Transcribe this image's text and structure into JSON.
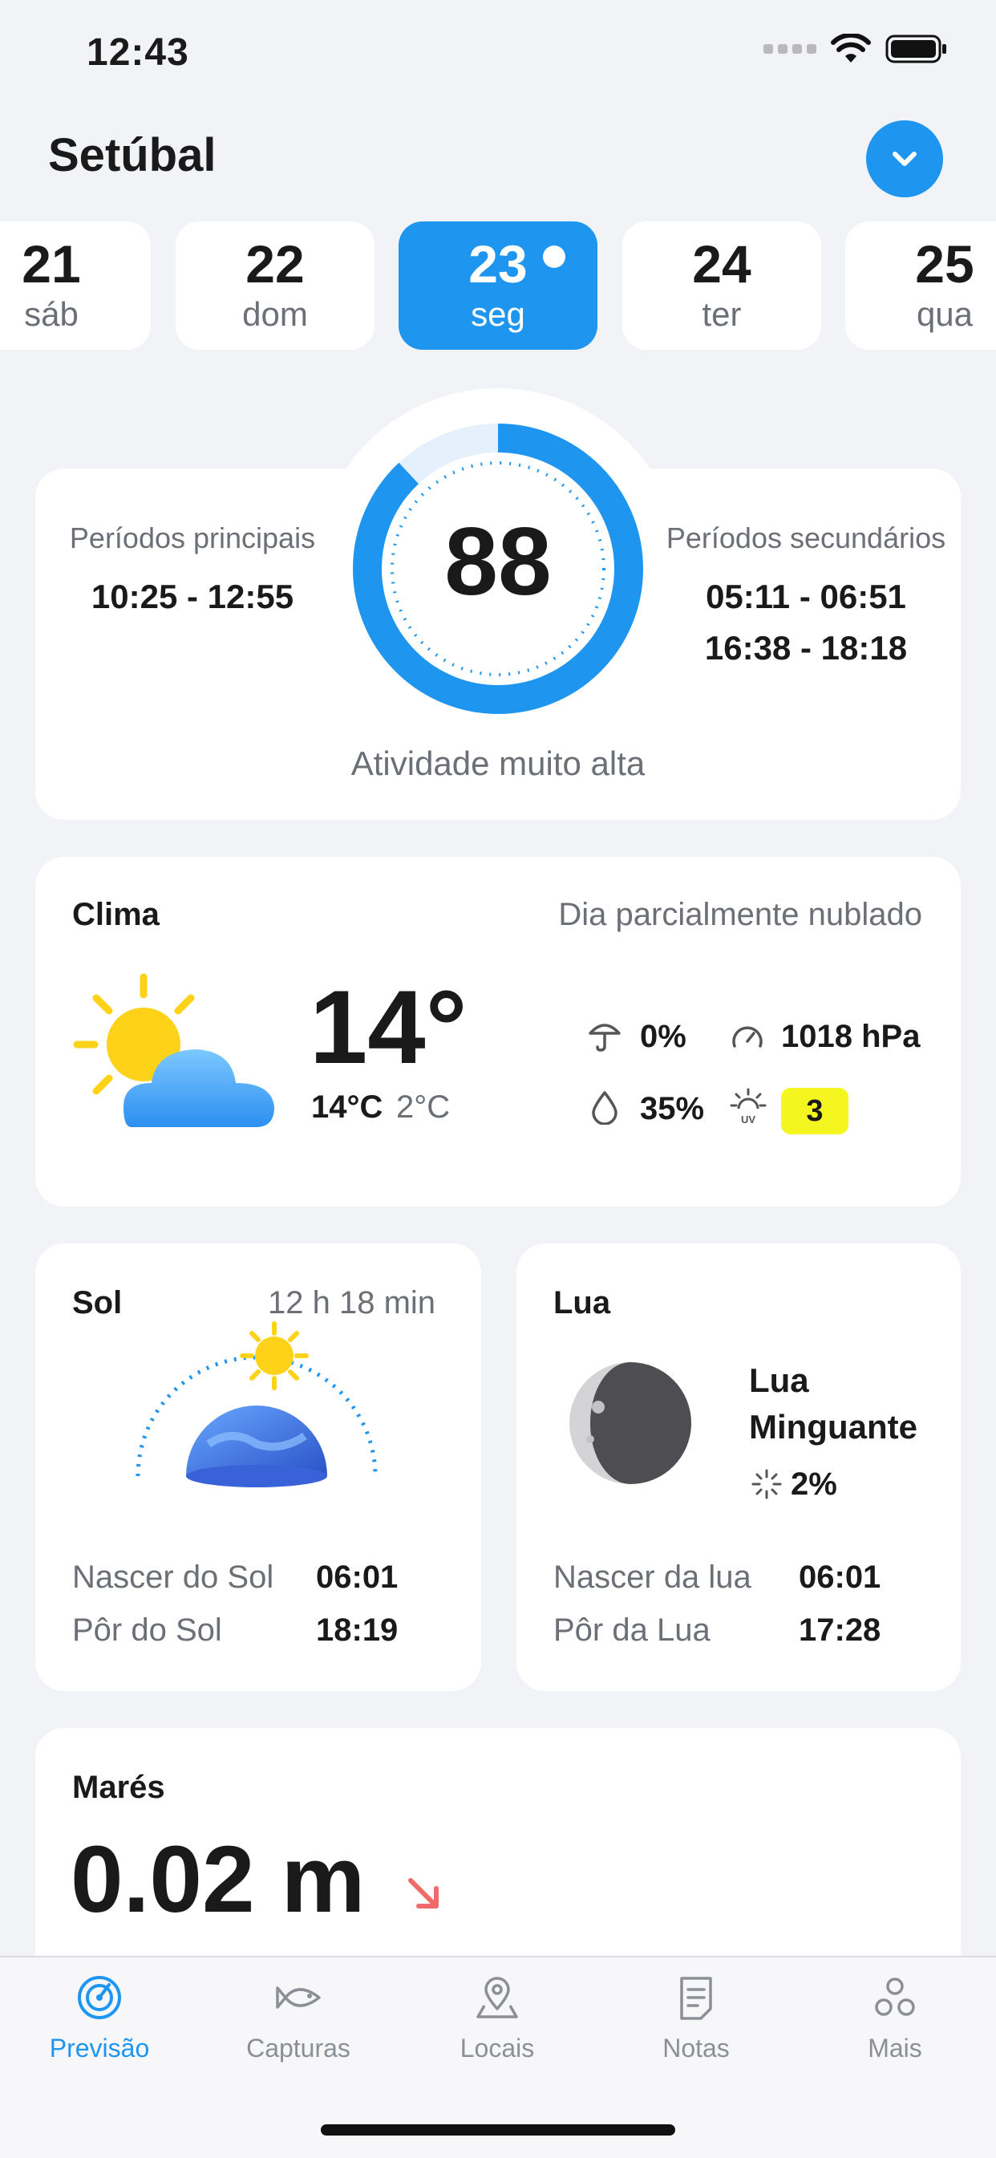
{
  "status": {
    "time": "12:43"
  },
  "header": {
    "title": "Setúbal"
  },
  "days": [
    {
      "num": "21",
      "dow": "sáb"
    },
    {
      "num": "22",
      "dow": "dom"
    },
    {
      "num": "23",
      "dow": "seg"
    },
    {
      "num": "24",
      "dow": "ter"
    },
    {
      "num": "25",
      "dow": "qua"
    }
  ],
  "activity": {
    "main_label": "Períodos principais",
    "main_period": "10:25 - 12:55",
    "secondary_label": "Períodos secundários",
    "secondary_periods": [
      "05:11 - 06:51",
      "16:38 - 18:18"
    ],
    "score": "88",
    "score_fraction": 0.88,
    "description": "Atividade muito alta"
  },
  "weather": {
    "title": "Clima",
    "summary": "Dia parcialmente nublado",
    "temp": "14°",
    "max": "14°C",
    "min": "2°C",
    "rain_chance": "0%",
    "pressure": "1018 hPa",
    "humidity": "35%",
    "uv": "3"
  },
  "sun": {
    "title": "Sol",
    "duration": "12 h 18 min",
    "rise_label": "Nascer do Sol",
    "rise": "06:01",
    "set_label": "Pôr do Sol",
    "set": "18:19"
  },
  "moon": {
    "title": "Lua",
    "phase_line1": "Lua",
    "phase_line2": "Minguante",
    "illumination": "2%",
    "rise_label": "Nascer da lua",
    "rise": "06:01",
    "set_label": "Pôr da Lua",
    "set": "17:28"
  },
  "tides": {
    "title": "Marés",
    "height": "0.02 m"
  },
  "tabs": [
    {
      "label": "Previsão",
      "icon": "forecast-icon"
    },
    {
      "label": "Capturas",
      "icon": "fish-icon"
    },
    {
      "label": "Locais",
      "icon": "location-icon"
    },
    {
      "label": "Notas",
      "icon": "notes-icon"
    },
    {
      "label": "Mais",
      "icon": "more-icon"
    }
  ],
  "colors": {
    "accent": "#1e96f0",
    "uv_badge": "#f5f520",
    "tide_arrow": "#f06a6a"
  }
}
